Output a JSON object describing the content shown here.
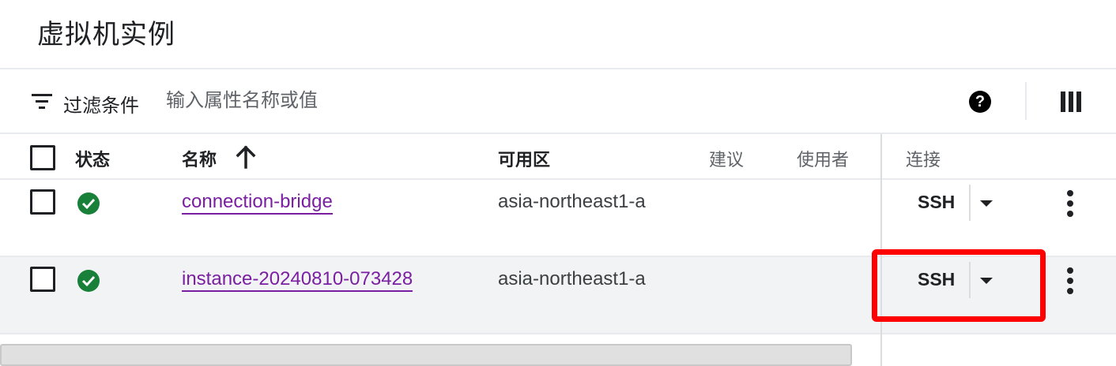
{
  "page": {
    "title": "虚拟机实例"
  },
  "filter": {
    "label": "过滤条件",
    "placeholder": "输入属性名称或值"
  },
  "toolbar": {
    "help_icon": "?",
    "help_icon_name": "help-icon",
    "columns_icon_name": "column-display-options-icon"
  },
  "table": {
    "headers": {
      "status": "状态",
      "name": "名称",
      "zone": "可用区",
      "recommendation": "建议",
      "in_use_by": "使用者",
      "connect": "连接"
    },
    "sort": {
      "column": "name",
      "direction": "ascending"
    },
    "rows": [
      {
        "status": "running",
        "name": "connection-bridge",
        "zone": "asia-northeast1-a",
        "connect": "SSH"
      },
      {
        "status": "running",
        "name": "instance-20240810-073428",
        "zone": "asia-northeast1-a",
        "connect": "SSH"
      }
    ]
  },
  "colors": {
    "link": "#7b1fa2",
    "status_ok": "#188038",
    "highlight": "#ff0000",
    "row_alt_bg": "#f1f3f4"
  }
}
